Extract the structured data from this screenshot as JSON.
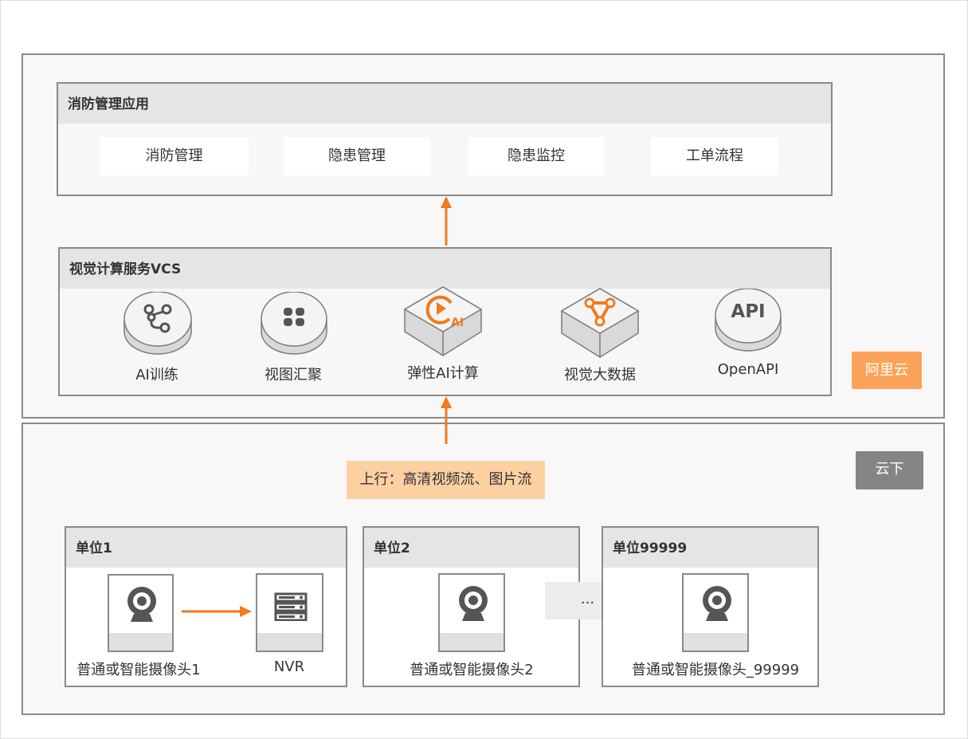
{
  "cloud": {
    "app_panel": {
      "title": "消防管理应用",
      "items": [
        "消防管理",
        "隐患管理",
        "隐患监控",
        "工单流程"
      ]
    },
    "vcs_panel": {
      "title": "视觉计算服务VCS",
      "items": [
        {
          "label": "AI训练",
          "icon": "network-nodes-icon"
        },
        {
          "label": "视图汇聚",
          "icon": "four-blocks-icon"
        },
        {
          "label": "弹性AI计算",
          "icon": "ai-play-icon"
        },
        {
          "label": "视觉大数据",
          "icon": "data-graph-icon"
        },
        {
          "label": "OpenAPI",
          "icon_text": "API"
        }
      ]
    },
    "badge": "阿里云"
  },
  "edge": {
    "badge": "云下",
    "upstream_label": "上行：高清视频流、图片流",
    "units": [
      {
        "title": "单位1",
        "devices": [
          {
            "label": "普通或智能摄像头1",
            "icon": "webcam-icon"
          },
          {
            "label": "NVR",
            "icon": "server-rack-icon"
          }
        ]
      },
      {
        "title": "单位2",
        "devices": [
          {
            "label": "普通或智能摄像头2",
            "icon": "webcam-icon"
          }
        ]
      },
      {
        "title": "单位99999",
        "devices": [
          {
            "label": "普通或智能摄像头_99999",
            "icon": "webcam-icon"
          }
        ]
      }
    ],
    "ellipsis": "..."
  },
  "colors": {
    "accent": "#f07a1c",
    "cloud_badge": "#fba35a",
    "edge_badge": "#858585",
    "upstream_bg": "#fdd0a2",
    "border": "#8a8a8a"
  }
}
